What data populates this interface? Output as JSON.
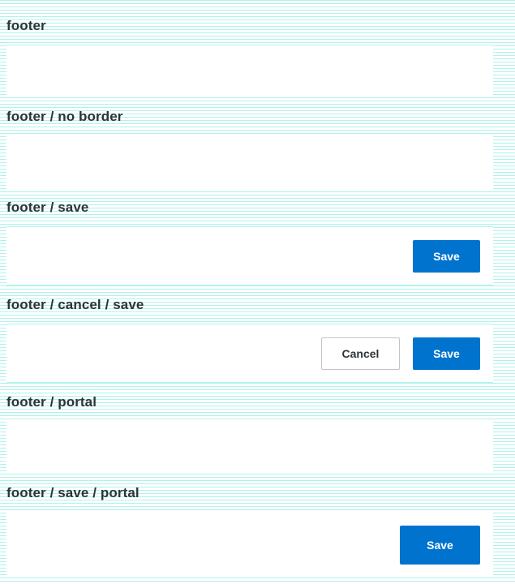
{
  "stories": [
    {
      "label": "footer"
    },
    {
      "label": "footer / no border"
    },
    {
      "label": "footer / save",
      "save_label": "Save"
    },
    {
      "label": "footer / cancel / save",
      "cancel_label": "Cancel",
      "save_label": "Save"
    },
    {
      "label": "footer / portal"
    },
    {
      "label": "footer / save / portal",
      "save_label": "Save"
    }
  ],
  "colors": {
    "primary": "#0073ce",
    "text": "#2d3338",
    "stripe": "#aef3ec",
    "panel": "#ffffff"
  }
}
